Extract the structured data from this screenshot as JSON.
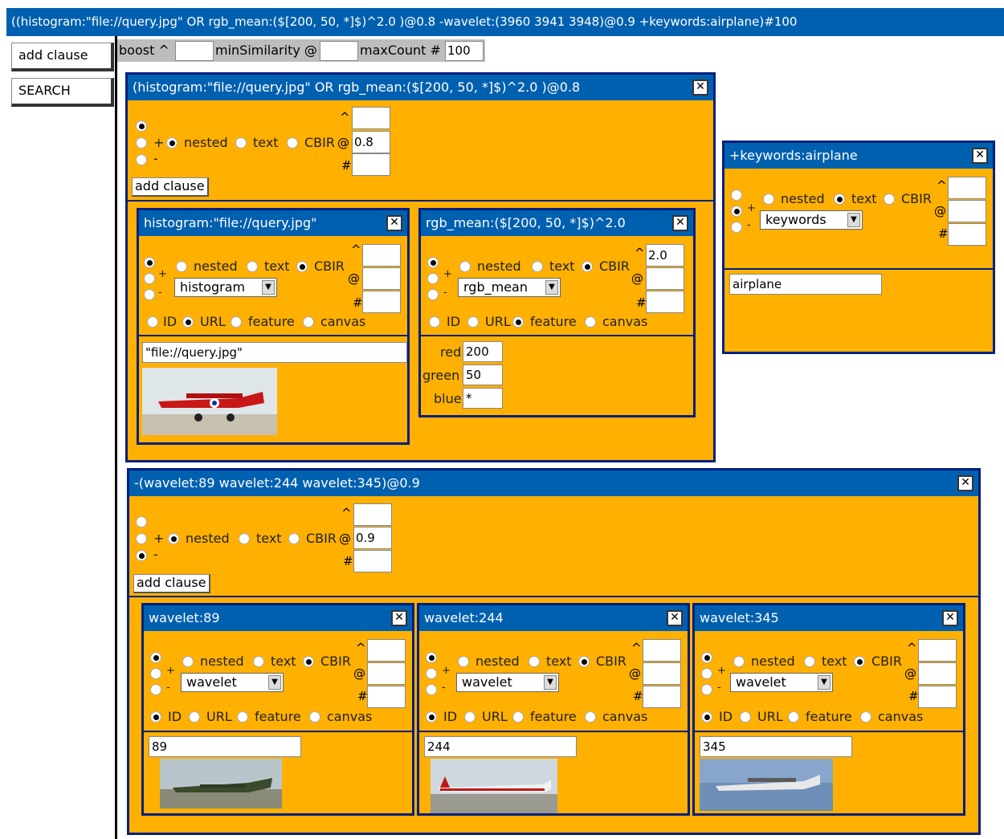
{
  "query": "((histogram:\"file://query.jpg\" OR rgb_mean:($[200, 50, *]$)^2.0 )@0.8 -wavelet:(3960 3941 3948)@0.9 +keywords:airplane)#100",
  "left": {
    "add_clause": "add clause",
    "search": "SEARCH"
  },
  "options": {
    "boost_label": "boost ^",
    "boost_value": "",
    "minsim_label": "minSimilarity @",
    "minsim_value": "",
    "maxcount_label": "maxCount #",
    "maxcount_value": "100"
  },
  "labels": {
    "plus": "+",
    "minus": "-",
    "nested": "nested",
    "text": "text",
    "cbir": "CBIR",
    "caret": "^",
    "at": "@",
    "hash": "#",
    "id": "ID",
    "url": "URL",
    "feature": "feature",
    "canvas": "canvas",
    "add_clause": "add clause",
    "close": "✕",
    "red": "red",
    "green": "green",
    "blue": "blue"
  },
  "panels": {
    "p1": {
      "title": "(histogram:\"file://query.jpg\" OR rgb_mean:($[200, 50, *]$)^2.0 )@0.8",
      "boost": "",
      "sim": "0.8",
      "count": ""
    },
    "hist": {
      "title": "histogram:\"file://query.jpg\"",
      "select": "histogram",
      "boost": "",
      "sim": "",
      "count": "",
      "value": "\"file://query.jpg\""
    },
    "rgb": {
      "title": "rgb_mean:($[200, 50, *]$)^2.0",
      "select": "rgb_mean",
      "boost": "2.0",
      "sim": "",
      "count": "",
      "red": "200",
      "green": "50",
      "blue": "*"
    },
    "kw": {
      "title": "+keywords:airplane",
      "select": "keywords",
      "boost": "",
      "sim": "",
      "count": "",
      "value": "airplane"
    },
    "p2": {
      "title": "-(wavelet:89 wavelet:244 wavelet:345)@0.9",
      "boost": "",
      "sim": "0.9",
      "count": ""
    },
    "w89": {
      "title": "wavelet:89",
      "select": "wavelet",
      "value": "89"
    },
    "w244": {
      "title": "wavelet:244",
      "select": "wavelet",
      "value": "244"
    },
    "w345": {
      "title": "wavelet:345",
      "select": "wavelet",
      "value": "345"
    }
  },
  "colors": {
    "title_bar": "#0060b0",
    "panel_bg": "#ffb000",
    "border": "#00207f"
  }
}
